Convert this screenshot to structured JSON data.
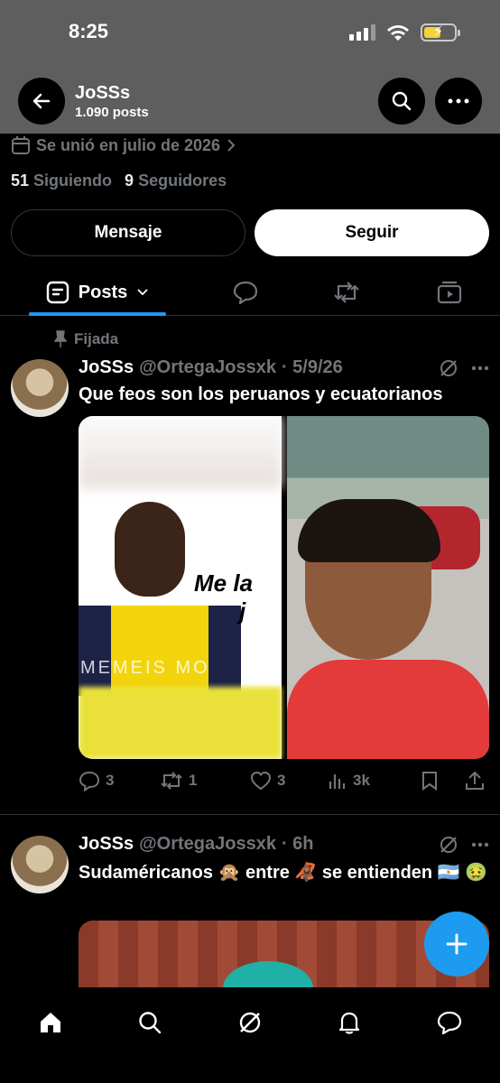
{
  "status_bar": {
    "time": "8:25",
    "battery_level": 0.55
  },
  "header": {
    "name": "JoSSs",
    "post_count": "1.090 posts"
  },
  "profile": {
    "joined": "Se unió en julio de 2026",
    "following_count": "51",
    "following_label": "Siguiendo",
    "followers_count": "9",
    "followers_label": "Seguidores",
    "message_button": "Mensaje",
    "follow_button": "Seguir"
  },
  "tabs": {
    "posts_label": "Posts"
  },
  "posts": [
    {
      "pinned_label": "Fijada",
      "name": "JoSSs",
      "handle": "@OrtegaJossxk",
      "time": "· 5/9/26",
      "text": "Que feos son los peruanos y ecuatorianos",
      "image_text_1": "Me la",
      "image_text_2": "j",
      "image_text_3": "MEMEIS MO",
      "replies": "3",
      "reposts": "1",
      "likes": "3",
      "views": "3k"
    },
    {
      "name": "JoSSs",
      "handle": "@OrtegaJossxk",
      "time": "· 6h",
      "text": "Sudaméricanos 🙊 entre 🦧 se entienden 🇦🇷 🤢"
    }
  ],
  "colors": {
    "accent": "#1d9bf0",
    "muted": "#71767b",
    "background": "#000000"
  },
  "icons": [
    "back-arrow-icon",
    "search-icon",
    "more-icon",
    "calendar-icon",
    "chevron-right-icon",
    "posts-tab-icon",
    "chevron-down-icon",
    "reply-icon",
    "repost-icon",
    "media-icon",
    "pin-icon",
    "grok-icon",
    "like-icon",
    "views-icon",
    "bookmark-icon",
    "share-icon",
    "plus-icon",
    "home-icon",
    "bell-icon",
    "messages-icon"
  ]
}
